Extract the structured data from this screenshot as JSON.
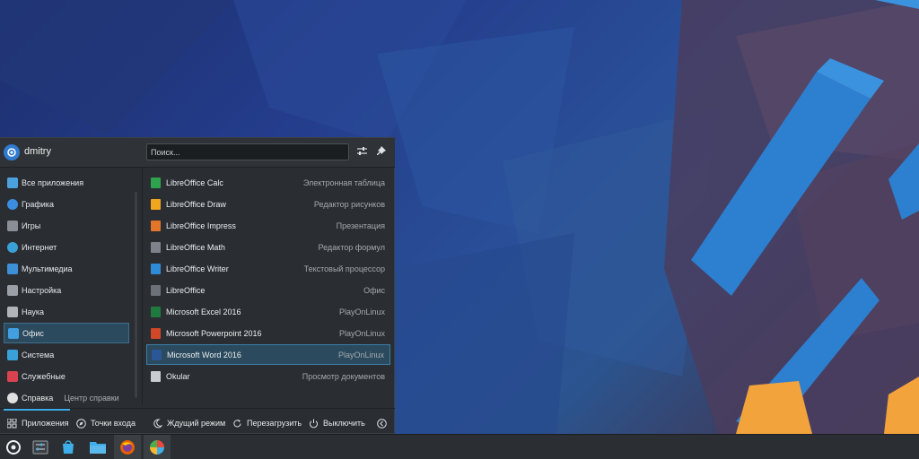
{
  "user": {
    "name": "dmitry"
  },
  "search": {
    "placeholder": "Поиск..."
  },
  "categories": [
    {
      "label": "Все приложения",
      "icon": "grid-apps-icon",
      "color": "#4aa3df"
    },
    {
      "label": "Графика",
      "icon": "graphics-icon",
      "color": "#3b8de0"
    },
    {
      "label": "Игры",
      "icon": "gamepad-icon",
      "color": "#8a8f95"
    },
    {
      "label": "Интернет",
      "icon": "globe-icon",
      "color": "#3aa0d8"
    },
    {
      "label": "Мультимедиа",
      "icon": "multimedia-icon",
      "color": "#3d8fd6"
    },
    {
      "label": "Настройка",
      "icon": "settings-panel-icon",
      "color": "#9aa0a6"
    },
    {
      "label": "Наука",
      "icon": "science-icon",
      "color": "#b0b5ba"
    },
    {
      "label": "Офис",
      "icon": "office-icon",
      "color": "#42a0e0"
    },
    {
      "label": "Система",
      "icon": "system-icon",
      "color": "#3aa0d8"
    },
    {
      "label": "Служебные",
      "icon": "utilities-icon",
      "color": "#d9434f"
    },
    {
      "label": "Справка",
      "sub": "Центр справки",
      "icon": "help-icon",
      "color": "#e0e0e0"
    }
  ],
  "selected_category": "Офис",
  "apps": [
    {
      "name": "LibreOffice Calc",
      "desc": "Электронная таблица",
      "icon": "libreoffice-calc-icon",
      "color": "#2ea24c"
    },
    {
      "name": "LibreOffice Draw",
      "desc": "Редактор рисунков",
      "icon": "libreoffice-draw-icon",
      "color": "#f0a71f"
    },
    {
      "name": "LibreOffice Impress",
      "desc": "Презентация",
      "icon": "libreoffice-impress-icon",
      "color": "#e3752b"
    },
    {
      "name": "LibreOffice Math",
      "desc": "Редактор формул",
      "icon": "libreoffice-math-icon",
      "color": "#7d8389"
    },
    {
      "name": "LibreOffice Writer",
      "desc": "Текстовый процессор",
      "icon": "libreoffice-writer-icon",
      "color": "#2f8ad8"
    },
    {
      "name": "LibreOffice",
      "desc": "Офис",
      "icon": "libreoffice-icon",
      "color": "#6b7177"
    },
    {
      "name": "Microsoft Excel 2016",
      "desc": "PlayOnLinux",
      "icon": "excel-icon",
      "color": "#1f7a3f"
    },
    {
      "name": "Microsoft Powerpoint 2016",
      "desc": "PlayOnLinux",
      "icon": "powerpoint-icon",
      "color": "#d24726"
    },
    {
      "name": "Microsoft Word 2016",
      "desc": "PlayOnLinux",
      "icon": "word-icon",
      "color": "#2b5797"
    },
    {
      "name": "Okular",
      "desc": "Просмотр документов",
      "icon": "okular-icon",
      "color": "#c8cdd2"
    }
  ],
  "selected_app": "Microsoft Word 2016",
  "footer": {
    "applications": "Приложения",
    "places": "Точки входа",
    "sleep": "Ждущий режим",
    "restart": "Перезагрузить",
    "shutdown": "Выключить"
  },
  "taskbar": [
    {
      "icon": "app-launcher-icon"
    },
    {
      "icon": "system-settings-icon"
    },
    {
      "icon": "discover-store-icon"
    },
    {
      "icon": "file-manager-icon"
    },
    {
      "icon": "firefox-icon"
    },
    {
      "icon": "playonlinux-icon"
    }
  ],
  "colors": {
    "accent": "#3daee9",
    "panel": "#2a2e32",
    "selection": "#2b4a5e"
  }
}
